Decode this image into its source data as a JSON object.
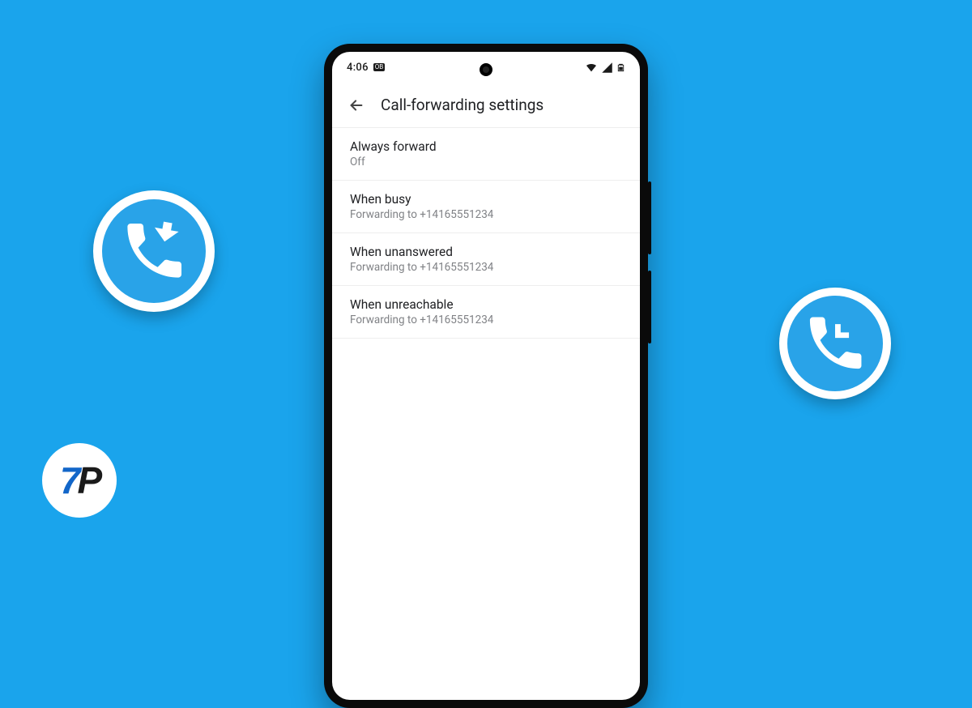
{
  "statusbar": {
    "time": "4:06",
    "badge": "OB"
  },
  "header": {
    "title": "Call-forwarding settings"
  },
  "rows": [
    {
      "title": "Always forward",
      "subtitle": "Off"
    },
    {
      "title": "When busy",
      "subtitle": "Forwarding to +14165551234"
    },
    {
      "title": "When unanswered",
      "subtitle": "Forwarding to +14165551234"
    },
    {
      "title": "When unreachable",
      "subtitle": "Forwarding to +14165551234"
    }
  ],
  "logo": {
    "text_1": "7",
    "text_2": "P"
  }
}
